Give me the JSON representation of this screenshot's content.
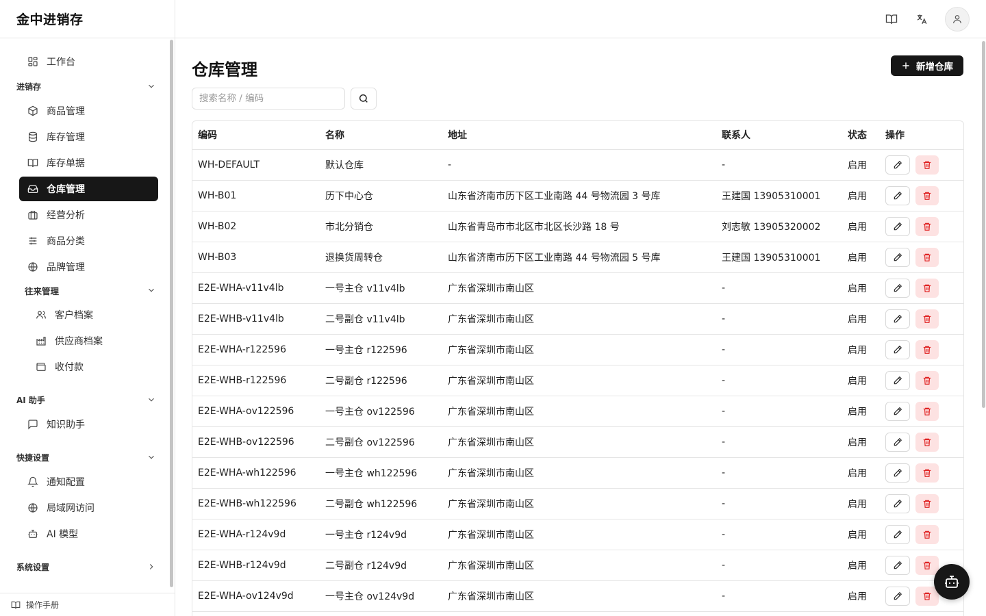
{
  "app": {
    "title": "金中进销存"
  },
  "colors": {
    "accent": "#171717",
    "danger": "#e02424",
    "danger_bg": "#fde2e2",
    "border": "#e5e5e5"
  },
  "sidebar": {
    "workbench": "工作台",
    "groups": {
      "jxc": "进销存",
      "wanglai": "往来管理",
      "ai": "AI 助手",
      "quick": "快捷设置",
      "system": "系统设置"
    },
    "items": {
      "products": "商品管理",
      "inventory": "库存管理",
      "stock_docs": "库存单据",
      "warehouse": "仓库管理",
      "analytics": "经营分析",
      "category": "商品分类",
      "brand": "品牌管理",
      "customers": "客户档案",
      "suppliers": "供应商档案",
      "payments": "收付款",
      "knowledge": "知识助手",
      "notify": "通知配置",
      "lan": "局域网访问",
      "ai_model": "AI 模型"
    },
    "footer": "操作手册"
  },
  "page": {
    "title": "仓库管理",
    "add_label": "新增仓库",
    "search_placeholder": "搜索名称 / 编码"
  },
  "table": {
    "headers": {
      "code": "编码",
      "name": "名称",
      "address": "地址",
      "contact": "联系人",
      "status": "状态",
      "ops": "操作"
    },
    "rows": [
      {
        "code": "WH-DEFAULT",
        "name": "默认仓库",
        "address": "-",
        "contact": "-",
        "status": "启用"
      },
      {
        "code": "WH-B01",
        "name": "历下中心仓",
        "address": "山东省济南市历下区工业南路 44 号物流园 3 号库",
        "contact": "王建国 13905310001",
        "status": "启用"
      },
      {
        "code": "WH-B02",
        "name": "市北分销仓",
        "address": "山东省青岛市市北区市北区长沙路 18 号",
        "contact": "刘志敏 13905320002",
        "status": "启用"
      },
      {
        "code": "WH-B03",
        "name": "退换货周转仓",
        "address": "山东省济南市历下区工业南路 44 号物流园 5 号库",
        "contact": "王建国 13905310001",
        "status": "启用"
      },
      {
        "code": "E2E-WHA-v11v4lb",
        "name": "一号主仓 v11v4lb",
        "address": "广东省深圳市南山区",
        "contact": "-",
        "status": "启用"
      },
      {
        "code": "E2E-WHB-v11v4lb",
        "name": "二号副仓 v11v4lb",
        "address": "广东省深圳市南山区",
        "contact": "-",
        "status": "启用"
      },
      {
        "code": "E2E-WHA-r122596",
        "name": "一号主仓 r122596",
        "address": "广东省深圳市南山区",
        "contact": "-",
        "status": "启用"
      },
      {
        "code": "E2E-WHB-r122596",
        "name": "二号副仓 r122596",
        "address": "广东省深圳市南山区",
        "contact": "-",
        "status": "启用"
      },
      {
        "code": "E2E-WHA-ov122596",
        "name": "一号主仓 ov122596",
        "address": "广东省深圳市南山区",
        "contact": "-",
        "status": "启用"
      },
      {
        "code": "E2E-WHB-ov122596",
        "name": "二号副仓 ov122596",
        "address": "广东省深圳市南山区",
        "contact": "-",
        "status": "启用"
      },
      {
        "code": "E2E-WHA-wh122596",
        "name": "一号主仓 wh122596",
        "address": "广东省深圳市南山区",
        "contact": "-",
        "status": "启用"
      },
      {
        "code": "E2E-WHB-wh122596",
        "name": "二号副仓 wh122596",
        "address": "广东省深圳市南山区",
        "contact": "-",
        "status": "启用"
      },
      {
        "code": "E2E-WHA-r124v9d",
        "name": "一号主仓 r124v9d",
        "address": "广东省深圳市南山区",
        "contact": "-",
        "status": "启用"
      },
      {
        "code": "E2E-WHB-r124v9d",
        "name": "二号副仓 r124v9d",
        "address": "广东省深圳市南山区",
        "contact": "-",
        "status": "启用"
      },
      {
        "code": "E2E-WHA-ov124v9d",
        "name": "一号主仓 ov124v9d",
        "address": "广东省深圳市南山区",
        "contact": "-",
        "status": "启用"
      }
    ]
  }
}
